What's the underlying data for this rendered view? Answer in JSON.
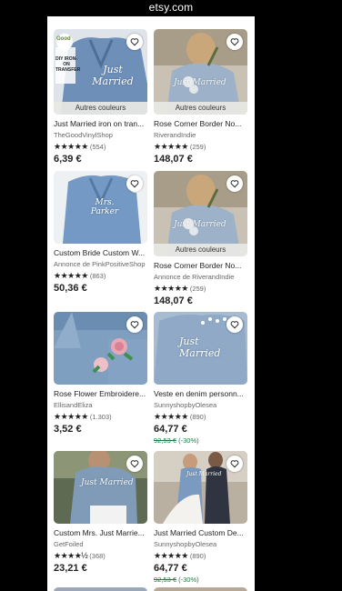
{
  "browser": {
    "domain": "etsy.com"
  },
  "labels": {
    "variant": "Autres couleurs"
  },
  "products": [
    {
      "title": "Just Married iron on tran...",
      "shop": "TheGoodVinylShop",
      "stars": "★★★★★",
      "reviews": "(554)",
      "price": "6,39 €",
      "has_variant": true,
      "photo_text": "Just Married",
      "badge_text": "DIY IRON-ON TRANSFER",
      "logo_text": "Good"
    },
    {
      "title": "Rose Corner Border No...",
      "shop": "RiverandIndie",
      "stars": "★★★★★",
      "reviews": "(259)",
      "price": "148,07 €",
      "has_variant": true,
      "photo_text": "Just Married"
    },
    {
      "title": "Custom Bride Custom W...",
      "shop": "Annonce de PinkPositiveShop",
      "stars": "★★★★★",
      "reviews": "(863)",
      "price": "50,36 €",
      "has_variant": false,
      "photo_text": "Mrs. Parker"
    },
    {
      "title": "Rose Corner Border No...",
      "shop": "Annonce de RiverandIndie",
      "stars": "★★★★★",
      "reviews": "(259)",
      "price": "148,07 €",
      "has_variant": true,
      "photo_text": "Just Married"
    },
    {
      "title": "Rose Flower Embroidere...",
      "shop": "EllisandEliza",
      "stars": "★★★★★",
      "reviews": "(1.303)",
      "price": "3,52 €",
      "has_variant": false
    },
    {
      "title": "Veste en denim personn...",
      "shop": "SunnyshopbyOlesea",
      "stars": "★★★★★",
      "reviews": "(890)",
      "price": "64,77 €",
      "old_price": "92,53 €",
      "discount": "(-30%)",
      "has_variant": false,
      "photo_text": "Just Married"
    },
    {
      "title": "Custom Mrs. Just Marrie...",
      "shop": "GetFoiled",
      "stars": "★★★★½",
      "reviews": "(368)",
      "price": "23,21 €",
      "has_variant": false,
      "photo_text": "Just Married"
    },
    {
      "title": "Just Married Custom De...",
      "shop": "SunnyshopbyOlesea",
      "stars": "★★★★★",
      "reviews": "(890)",
      "price": "64,77 €",
      "old_price": "92,53 €",
      "discount": "(-30%)",
      "has_variant": false,
      "photo_text": "Just Married"
    }
  ]
}
